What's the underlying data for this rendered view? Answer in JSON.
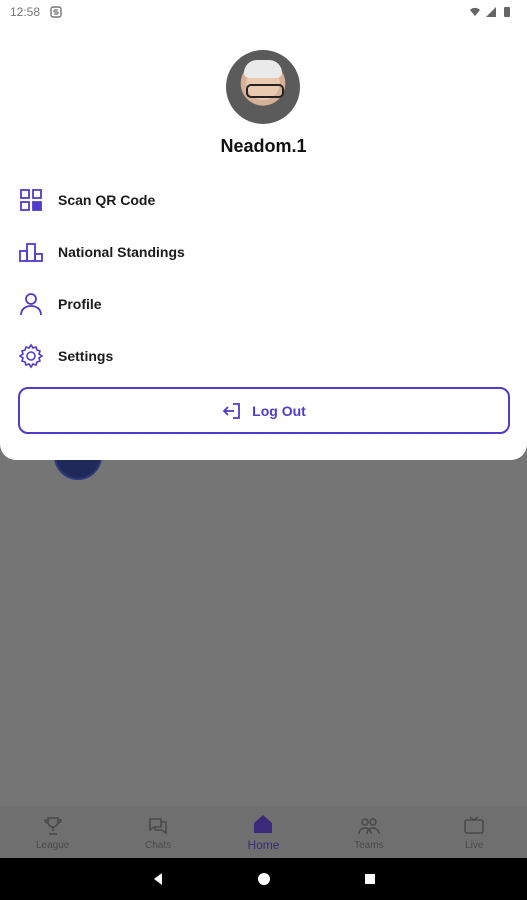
{
  "status_bar": {
    "time": "12:58",
    "notif_icon": "s-icon",
    "wifi_icon": "wifi-icon",
    "signal_icon": "signal-icon",
    "battery_icon": "battery-icon"
  },
  "profile": {
    "username": "Neadom.1",
    "avatar_icon": "avatar"
  },
  "menu": {
    "items": [
      {
        "label": "Scan QR Code",
        "icon": "qr-code-icon"
      },
      {
        "label": "National Standings",
        "icon": "standings-icon"
      },
      {
        "label": "Profile",
        "icon": "user-icon"
      },
      {
        "label": "Settings",
        "icon": "gear-icon"
      }
    ],
    "logout_label": "Log Out",
    "logout_icon": "logout-icon"
  },
  "bottom_nav": {
    "items": [
      {
        "label": "League",
        "icon": "trophy-icon"
      },
      {
        "label": "Chats",
        "icon": "chat-icon"
      },
      {
        "label": "Home",
        "icon": "home-icon",
        "active": true
      },
      {
        "label": "Teams",
        "icon": "teams-icon"
      },
      {
        "label": "Live",
        "icon": "tv-icon"
      }
    ]
  },
  "colors": {
    "accent": "#4f3cc9",
    "text": "#1b1b1b",
    "overlay": "#757575"
  }
}
